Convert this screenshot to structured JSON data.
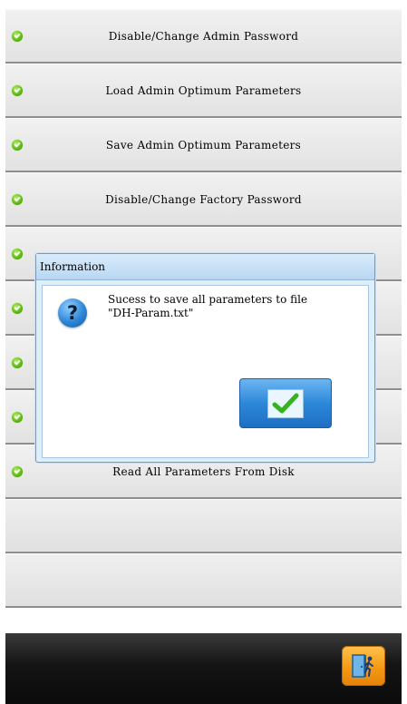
{
  "menu": {
    "items": [
      {
        "label": "Disable/Change Admin Password"
      },
      {
        "label": "Load Admin Optimum Parameters"
      },
      {
        "label": "Save Admin Optimum Parameters"
      },
      {
        "label": "Disable/Change Factory Password"
      },
      {
        "label": ""
      },
      {
        "label": ""
      },
      {
        "label": ""
      },
      {
        "label": ""
      },
      {
        "label": "Read All Parameters From Disk"
      },
      {
        "label": ""
      },
      {
        "label": ""
      }
    ]
  },
  "dialog": {
    "title": "Information",
    "message": "Sucess to save all parameters to file\n\"DH-Param.txt\"",
    "icon": "question-icon",
    "ok_icon": "checkmark-icon"
  },
  "bottombar": {
    "exit_icon": "exit-door-icon"
  },
  "colors": {
    "status_dot": "#5bb514",
    "exit_button": "#f59a13",
    "ok_button": "#2d88da",
    "bottom_bar": "#141414"
  }
}
